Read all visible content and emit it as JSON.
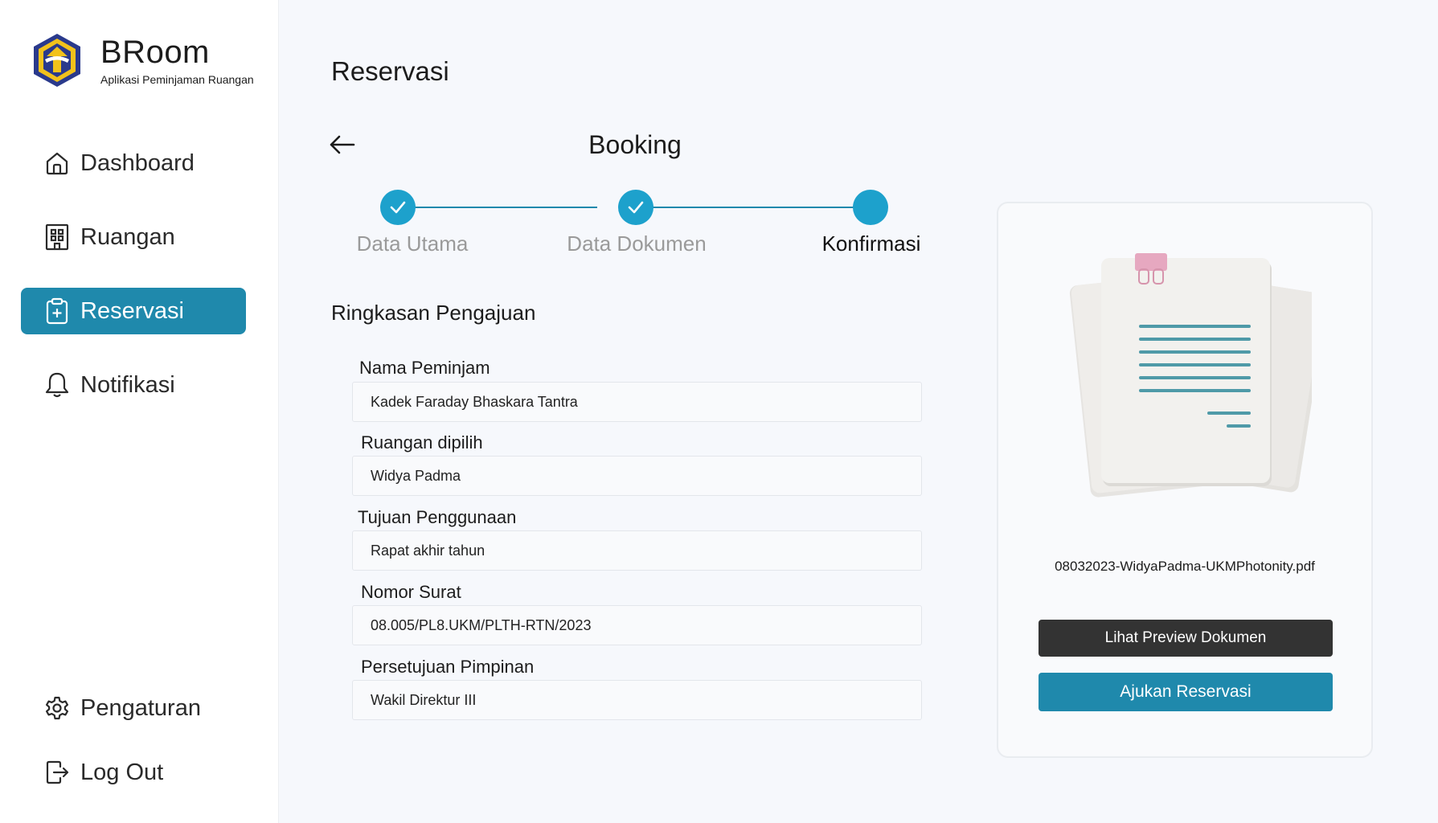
{
  "brand": {
    "name": "BRoom",
    "subtitle": "Aplikasi Peminjaman Ruangan"
  },
  "sidebar": {
    "items": [
      {
        "label": "Dashboard",
        "icon": "home-icon",
        "active": false
      },
      {
        "label": "Ruangan",
        "icon": "building-icon",
        "active": false
      },
      {
        "label": "Reservasi",
        "icon": "clipboard-plus-icon",
        "active": true
      },
      {
        "label": "Notifikasi",
        "icon": "bell-icon",
        "active": false
      }
    ],
    "bottom_items": [
      {
        "label": "Pengaturan",
        "icon": "gear-icon"
      },
      {
        "label": "Log Out",
        "icon": "logout-icon"
      }
    ]
  },
  "page": {
    "title": "Reservasi",
    "subtitle": "Booking"
  },
  "stepper": {
    "steps": [
      {
        "label": "Data Utama",
        "state": "done"
      },
      {
        "label": "Data Dokumen",
        "state": "done"
      },
      {
        "label": "Konfirmasi",
        "state": "current"
      }
    ]
  },
  "summary": {
    "title": "Ringkasan Pengajuan",
    "fields": [
      {
        "label": "Nama Peminjam",
        "value": "Kadek Faraday Bhaskara Tantra"
      },
      {
        "label": "Ruangan dipilih",
        "value": "Widya Padma"
      },
      {
        "label": "Tujuan Penggunaan",
        "value": "Rapat akhir tahun"
      },
      {
        "label": "Nomor Surat",
        "value": "08.005/PL8.UKM/PLTH-RTN/2023"
      },
      {
        "label": "Persetujuan Pimpinan",
        "value": "Wakil Direktur III"
      }
    ]
  },
  "document": {
    "file_name": "08032023-WidyaPadma-UKMPhotonity.pdf",
    "preview_label": "Lihat Preview Dokumen",
    "submit_label": "Ajukan Reservasi"
  },
  "colors": {
    "accent": "#1f89ac",
    "step": "#1da1cc",
    "dark_button": "#333333",
    "logo_blue": "#2a3a8c",
    "logo_yellow": "#f2c21b"
  }
}
